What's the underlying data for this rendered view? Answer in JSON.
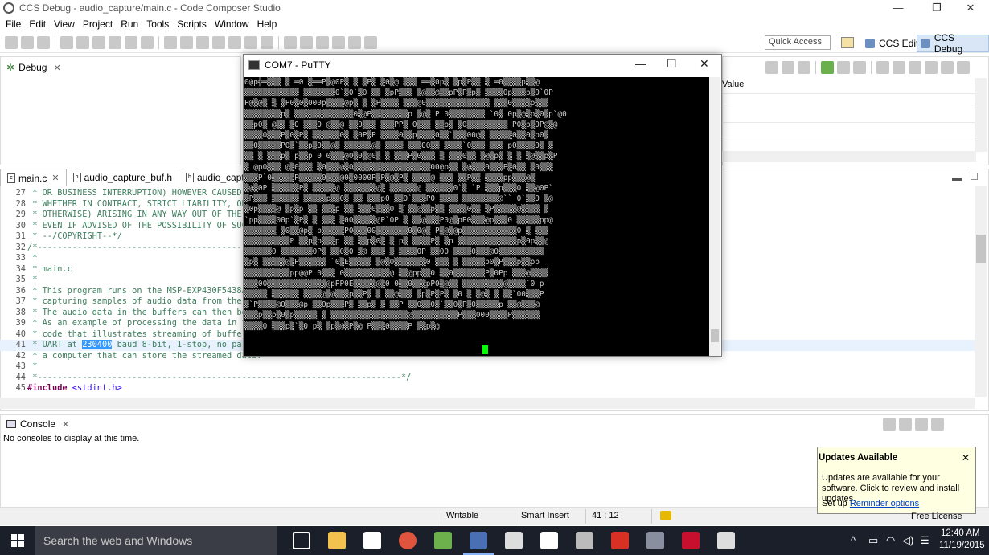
{
  "window": {
    "title": "CCS Debug - audio_capture/main.c - Code Composer Studio"
  },
  "menu": [
    "File",
    "Edit",
    "View",
    "Project",
    "Run",
    "Tools",
    "Scripts",
    "Window",
    "Help"
  ],
  "toolbar": {
    "quick_access_placeholder": "Quick Access",
    "perspective_edit": "CCS Edit",
    "perspective_debug": "CCS Debug"
  },
  "debug_view": {
    "tab": "Debug"
  },
  "variables_view": {
    "column_value": "Value"
  },
  "editor": {
    "tabs": [
      "main.c",
      "audio_capture_buf.h",
      "audio_captur"
    ],
    "lines": [
      {
        "n": "27",
        "text": " * OR BUSINESS INTERRUPTION) HOWEVER CAUSED AND ON ANY THEORY OF LIABILITY,"
      },
      {
        "n": "28",
        "text": " * WHETHER IN CONTRACT, STRICT LIABILITY, OR TORT (INCLUDING NEGLIGENCE OR"
      },
      {
        "n": "29",
        "text": " * OTHERWISE) ARISING IN ANY WAY OUT OF THE USE OF THIS SOFTWARE,"
      },
      {
        "n": "30",
        "text": " * EVEN IF ADVISED OF THE POSSIBILITY OF SUCH DAMAGE."
      },
      {
        "n": "31",
        "text": " * --/COPYRIGHT--*/"
      },
      {
        "n": "32",
        "text": "/*--------------------------------------------------------------------------"
      },
      {
        "n": "33",
        "text": " *"
      },
      {
        "n": "34",
        "text": " * main.c"
      },
      {
        "n": "35",
        "text": " *"
      },
      {
        "n": "36",
        "text": " * This program runs on the MSP-EXP430F5438A"
      },
      {
        "n": "37",
        "text": " * capturing samples of audio data from the"
      },
      {
        "n": "38",
        "text": " * The audio data in the buffers can then be"
      },
      {
        "n": "39",
        "text": " * As an example of processing the data in the"
      },
      {
        "n": "40",
        "text": " * code that illustrates streaming of buffered"
      },
      {
        "n": "41",
        "pre": " * UART at ",
        "sel": "230400",
        "post": " baud 8-bit, 1-stop, no parity"
      },
      {
        "n": "42",
        "text": " * a computer that can store the streamed data."
      },
      {
        "n": "43",
        "text": " *"
      },
      {
        "n": "44",
        "text": " *-------------------------------------------------------------------------*/"
      },
      {
        "n": "45",
        "kw": "#include",
        "inc": " <stdint.h>"
      }
    ]
  },
  "console": {
    "tab": "Console",
    "message": "No consoles to display at this time."
  },
  "status": {
    "mode": "Writable",
    "insert": "Smart Insert",
    "position": "41 : 12",
    "license": "Free License"
  },
  "updates": {
    "title": "Updates Available",
    "body": "Updates are available for your software. Click to review and install updates.",
    "setup_prefix": "Set up ",
    "link": "Reminder options"
  },
  "putty": {
    "title": "COM7 - PuTTY",
    "lines": [
      "0@p╬═▒▒▒ ▒ ═0 ▒══P▒@0P▒ ▒ ▒P▒ ▒0▒@ ▒▒▒ ══▒0p▒ ▒p▒P▒▒ ▒ ═0▒▒▒▒p▒▒@",
      "▒▒▒▒▒▒▒▒▒▒▒▒ ▒▒▒▒▒▒▒0`▒0`▒0 ▒▒ ▒pP▒▒▒ ▒@▒▒@▒▒pP▒P▒p▒ ▒▒▒▒0p▒▒▒p▒0`0P",
      "P@▒@▒`▒ ▒P0▒0▒000p▒▒▒▒@p▒ ▒ ▒P▒▒▒▒ ▒▒▒@0▒▒▒▒▒▒▒▒▒▒▒▒▒▒ ▒▒▒0▒▒▒▒p▒▒▒",
      "▒▒▒▒▒▒▒▒p▒ ▒▒▒▒▒▒▒▒▒▒▒▒▒0▒@P▒▒▒▒▒▒▒▒p ▒@▒ P 0▒▒▒▒▒▒▒▒ `0▒ 0p▒@▒p▒0▒p`@0",
      "▒▒p0▒ @▒▒ ▒0 ▒▒▒0 @▒▒@ ▒▒0▒▒▒ ▒▒▒PP▒ 0▒▒▒ ▒▒p▒ ▒0▒▒▒▒▒▒▒▒▒ P0▒p▒0P@▒@",
      "▒▒▒▒0▒▒▒P▒0▒P▒ ▒▒▒▒▒▒0▒ ▒0P▒P ▒▒▒▒0▒▒p▒▒▒▒0▒▒`▒▒▒00@▒ ▒▒▒▒▒0▒▒0▒p0▒",
      "▒▒0▒▒▒▒▒P0▒`▒▒p▒0▒▒@▒ ▒▒▒▒▒▒@▒ ▒▒▒▒ ▒▒▒00▒▒ ▒▒▒▒`0▒▒▒ ▒▒▒ p0▒▒▒▒0▒ ▒",
      "▒▒ ▒ ▒▒▒p▒ p▒▒p 0 0▒▒▒@0▒0▒@0▒ ▒ ▒▒▒P▒0▒▒▒ ▒ ▒▒▒0▒▒ ▒@▒p▒ ▒ ▒ ▒@▒▒p▒P",
      "▒ @p0▒▒▒ @▒0▒▒▒ ▒0▒▒▒@▒0▒▒▒▒▒▒▒▒▒▒▒▒▒▒▒▒▒00@p▒▒ ▒@▒▒▒0▒▒▒P▒0▒▒ ▒0▒▒▒",
      "▒▒▒P`0▒▒▒▒▒P▒▒▒▒▒0▒▒▒@0▒0000P▒P▒@▒P▒ ▒▒▒▒@ ▒▒▒ ▒▒P▒▒ ▒▒▒▒pp▒▒▒@▒",
      "▒@▒0P ▒▒▒▒▒▒P▒ ▒▒▒▒▒@ ▒▒▒▒▒▒▒@▒ ▒▒▒▒▒▒@ ▒▒▒▒▒▒0`▒ `P ▒▒▒p▒▒▒0 ▒▒@0P`",
      "▒P▒▒▒ ▒▒▒▒▒▒ ▒▒▒▒▒p▒▒0▒ ▒▒ ▒▒▒p0 ▒▒0`▒▒▒P0 ▒▒▒▒ ▒▒▒▒▒▒▒▒@`` 0`▒▒0 ▒@",
      "▒0p▒▒▒▒@ ▒p▒p ▒▒ ▒▒▒p ▒▒ ▒▒▒0▒▒▒0`▒`▒▒@▒▒p▒▒ ▒▒▒▒0▒▒ ▒P▒▒▒▒▒@▒▒▒▒ ▒",
      "`pp▒▒▒▒00p`▒P▒ ▒ ▒▒▒ ▒00▒▒▒▒▒@P`0P ▒ ▒▒@▒▒▒P0@▒pP0▒▒▒@p▒▒▒0 ▒▒▒▒▒pp@",
      "▒▒▒▒▒▒▒ ▒0▒▒@p▒ p▒▒▒▒▒P0▒▒▒00▒▒▒▒▒▒▒0▒0@▒ P▒@▒@p▒▒▒▒▒▒▒▒▒▒▒▒0 ▒ ▒▒▒",
      "▒▒▒▒▒▒▒▒▒▒P ▒▒p▒p▒▒▒p ▒▒ ▒▒p▒0▒ ▒ p▒ ▒▒▒▒P▒ ▒p ▒▒▒▒▒▒▒▒▒▒▒▒▒p▒0p▒▒@",
      "▒▒▒▒▒▒0 ▒▒▒▒▒▒▒0P▒ ▒▒0▒0 ▒@ ▒▒▒ ▒ ▒▒▒▒0P ▒▒00 ▒▒▒▒0▒▒▒@0▒▒▒▒▒▒▒▒▒▒",
      "▒p▒ ▒▒▒▒▒@▒P▒▒▒▒▒▒ `0▒E▒▒▒▒▒ ▒@▒0▒▒▒▒▒▒▒0 ▒▒▒ ▒ ▒▒▒▒▒p0▒P▒▒▒p▒▒pp",
      "▒▒▒▒▒▒▒▒▒▒pp@@P 0▒▒▒ 0▒▒▒▒▒▒▒▒▒▒@ ▒▒@pp▒▒0 ▒▒0▒▒▒▒▒▒▒P▒0Pp ▒▒▒@▒▒▒▒",
      "▒▒▒00▒▒▒▒▒▒▒▒▒▒▒▒▒@pPP0E▒▒▒▒▒@▒0 0▒▒0▒▒▒pP0▒@▒▒ ▒▒▒▒▒▒▒▒▒@▒▒▒▒`0 p",
      "▒▒▒▒▒ ▒▒▒▒▒▒ ▒▒▒▒@▒@▒▒▒p▒▒P▒ ▒ ▒▒@▒▒▒ ▒p▒P▒P▒ ▒0 ▒ ▒@▒ ▒ ▒▒`00▒▒▒P",
      "▒`P▒▒▒▒@0▒▒▒@p ▒▒0p▒▒▒P▒ ▒▒p▒ ▒ ▒▒P ▒▒0▒▒0▒`▒▒0▒P▒0▒▒▒▒▒p ▒▒@▒▒▒@",
      "▒▒▒p▒▒p▒0▒p▒▒▒▒▒ ▒ ▒▒▒▒▒▒▒▒▒▒▒▒▒▒▒▒▒@▒▒▒▒▒▒▒▒▒▒P▒▒▒000▒▒▒▒P▒▒▒▒▒▒",
      "▒▒▒▒0 ▒▒▒p▒`▒0 p▒ ▒p▒@▒P▒@ P▒▒▒0▒▒▒▒P ▒▒p▒@"
    ]
  },
  "taskbar": {
    "search_placeholder": "Search the web and Windows",
    "time": "12:40 AM",
    "date": "11/19/2015"
  }
}
